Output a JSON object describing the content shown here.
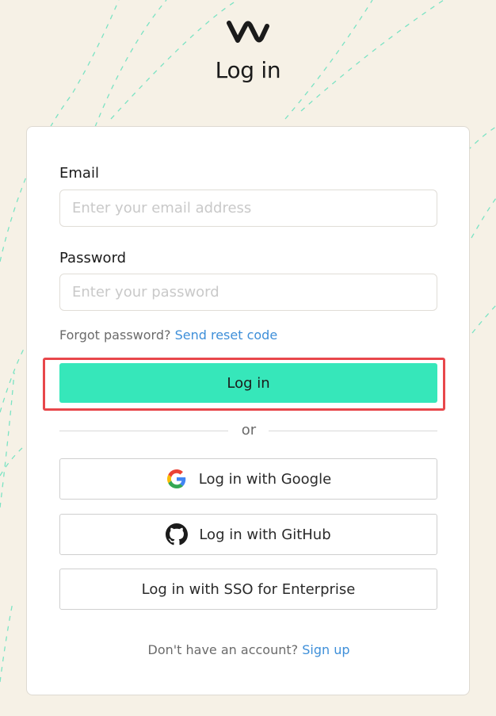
{
  "header": {
    "title": "Log in"
  },
  "form": {
    "email_label": "Email",
    "email_placeholder": "Enter your email address",
    "email_value": "",
    "password_label": "Password",
    "password_placeholder": "Enter your password",
    "password_value": "",
    "forgot_text": "Forgot password?",
    "reset_link": "Send reset code",
    "login_button": "Log in"
  },
  "divider": {
    "text": "or"
  },
  "providers": {
    "google": "Log in with Google",
    "github": "Log in with GitHub",
    "sso": "Log in with SSO for Enterprise"
  },
  "footer": {
    "prompt": "Don't have an account?",
    "signup_link": "Sign up"
  },
  "icons": {
    "logo": "brand-logo-icon",
    "google": "google-icon",
    "github": "github-icon"
  },
  "colors": {
    "background": "#f6f1e6",
    "accent": "#36e7ba",
    "link": "#3e8fd9",
    "highlight": "#e8474b",
    "decorative_lines": "#6ee2c0"
  }
}
